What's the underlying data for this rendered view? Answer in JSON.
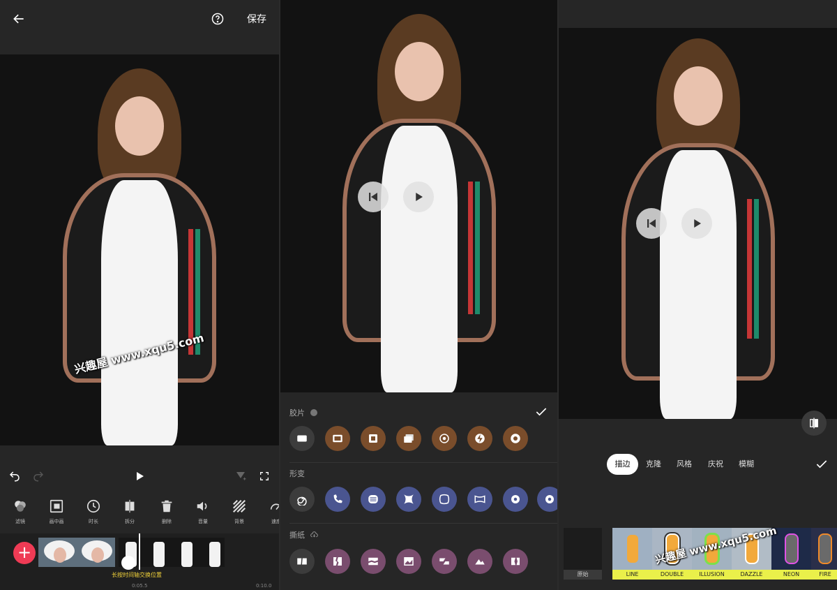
{
  "screen1": {
    "save_label": "保存",
    "tools": [
      {
        "label": "滤镜",
        "icon": "filter-icon"
      },
      {
        "label": "画中画",
        "icon": "pip-icon"
      },
      {
        "label": "时长",
        "icon": "clock-icon"
      },
      {
        "label": "拆分",
        "icon": "split-icon"
      },
      {
        "label": "删除",
        "icon": "trash-icon"
      },
      {
        "label": "音量",
        "icon": "volume-icon"
      },
      {
        "label": "背景",
        "icon": "background-icon"
      },
      {
        "label": "速度",
        "icon": "speed-icon"
      }
    ],
    "hint": "长按时间轴交换位置",
    "time_mid": "0:05.5",
    "time_end": "0:10.0",
    "watermark": "兴趣屋 www.xqu5.com"
  },
  "screen2": {
    "section_film": "胶片",
    "section_morph": "形变",
    "section_tear": "撕纸"
  },
  "screen3": {
    "tabs": [
      "描边",
      "克隆",
      "风格",
      "庆祝",
      "模糊"
    ],
    "active_tab": "描边",
    "original_label": "原始",
    "filters": [
      "LINE",
      "DOUBLE",
      "ILLUSION",
      "DAZZLE",
      "NEON",
      "FIRE"
    ],
    "watermark": "兴趣屋 www.xqu5.com"
  },
  "colors": {
    "accent_red": "#ef3b55",
    "hint_yellow": "#f1d23a",
    "filter_label_bg": "#eaf04a"
  }
}
